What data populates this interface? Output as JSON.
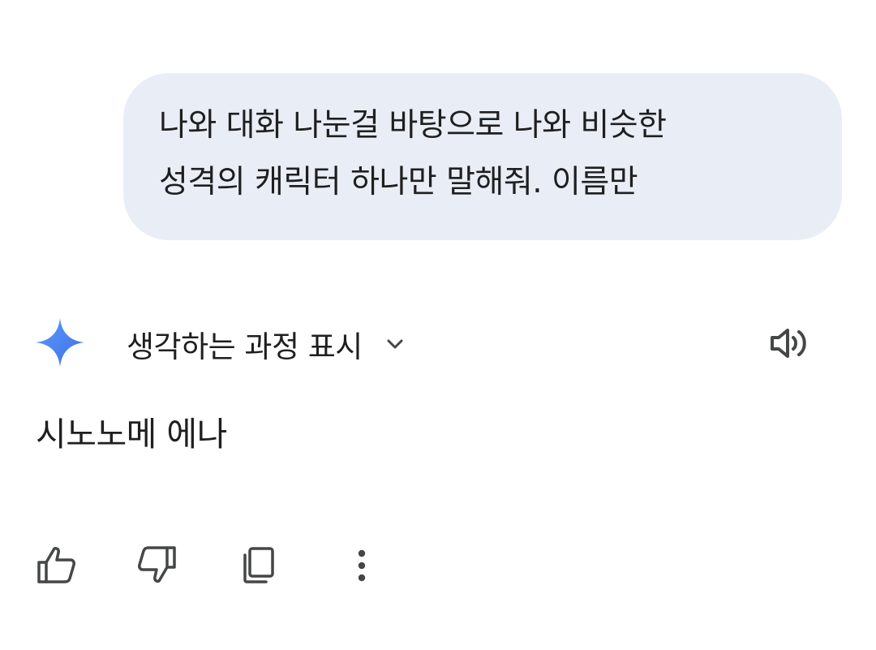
{
  "user_message": {
    "line1": "나와 대화 나눈걸 바탕으로 나와 비슷한",
    "line2": "성격의 캐릭터 하나만 말해줘. 이름만"
  },
  "response": {
    "show_thinking_label": "생각하는 과정 표시",
    "answer": "시노노메 에나"
  },
  "icons": {
    "assistant": "gemini-sparkle-icon",
    "expand": "chevron-down-icon",
    "read_aloud": "speaker-icon",
    "like": "thumbs-up-icon",
    "dislike": "thumbs-down-icon",
    "copy": "copy-icon",
    "more": "more-vertical-icon"
  },
  "colors": {
    "bubble_bg": "#e9eef6",
    "text": "#1f1f1f",
    "icon": "#444746",
    "sparkle_top": "#4f8df5",
    "sparkle_bottom": "#3b6fe0"
  }
}
